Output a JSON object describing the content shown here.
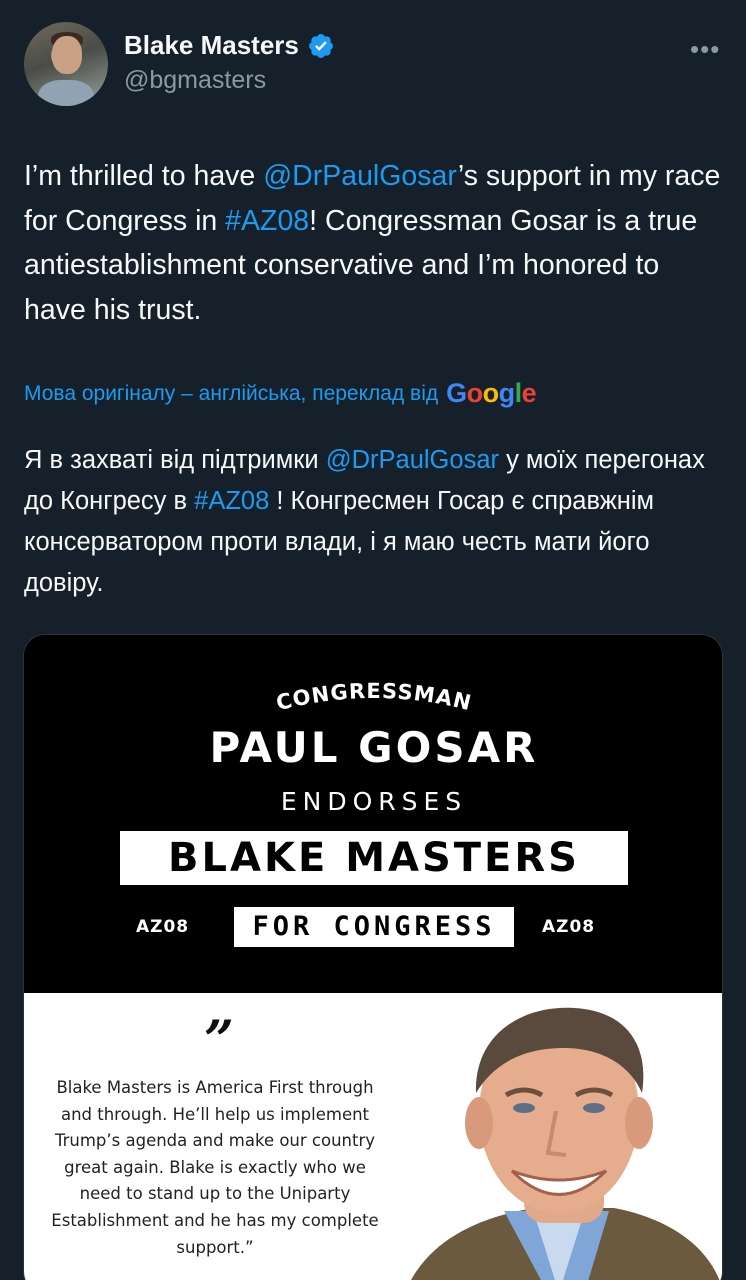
{
  "author": {
    "display_name": "Blake Masters",
    "handle": "@bgmasters",
    "verified_color": "#1d9bf0"
  },
  "tweet": {
    "p1": "I’m thrilled to have ",
    "mention": "@DrPaulGosar",
    "p2": "’s support in my race for Congress in ",
    "hashtag": "#AZ08",
    "p3": "!  Congressman Gosar is a true antiestablishment conservative and I’m honored to have his trust."
  },
  "translation": {
    "label": "Мова оригіналу – англійська, переклад від",
    "provider": "Google",
    "p1": "Я в захваті від підтримки ",
    "mention": "@DrPaulGosar",
    "p2": " у моїх перегонах до Конгресу в ",
    "hashtag": "#AZ08",
    "p3": " ! Конгресмен Госар є справжнім консерватором проти влади, і я маю честь мати його довіру."
  },
  "media": {
    "arc_title": "CONGRESSMAN",
    "endorser": "PAUL GOSAR",
    "endorses": "ENDORSES",
    "candidate": "BLAKE MASTERS",
    "district_left": "AZ08",
    "for_congress": "FOR CONGRESS",
    "district_right": "AZ08",
    "quote_mark": "”",
    "quote": "Blake Masters is America First through and through. He’ll help us implement Trump’s agenda and make our country great again. Blake is exactly who we need to stand up to the Uniparty Establishment and he has my complete support.”"
  },
  "icons": {
    "verified": "verified-badge-icon",
    "more": "more-options-icon"
  }
}
